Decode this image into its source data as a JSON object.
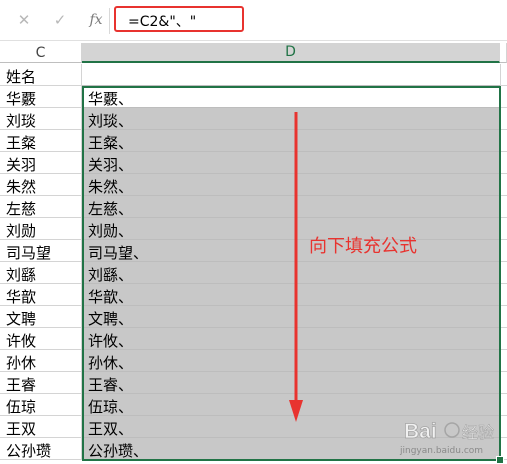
{
  "formula_bar": {
    "cancel_icon": "✕",
    "enter_icon": "✓",
    "fx_label": "fx",
    "formula": "=C2&\"、\""
  },
  "columns": {
    "c": "C",
    "d": "D"
  },
  "rows": [
    {
      "c": "姓名",
      "d": ""
    },
    {
      "c": "华覈",
      "d": "华覈、"
    },
    {
      "c": "刘琰",
      "d": "刘琰、"
    },
    {
      "c": "王粲",
      "d": "王粲、"
    },
    {
      "c": "关羽",
      "d": "关羽、"
    },
    {
      "c": "朱然",
      "d": "朱然、"
    },
    {
      "c": "左慈",
      "d": "左慈、"
    },
    {
      "c": "刘勋",
      "d": "刘勋、"
    },
    {
      "c": "司马望",
      "d": "司马望、"
    },
    {
      "c": "刘繇",
      "d": "刘繇、"
    },
    {
      "c": "华歆",
      "d": "华歆、"
    },
    {
      "c": "文聘",
      "d": "文聘、"
    },
    {
      "c": "许攸",
      "d": "许攸、"
    },
    {
      "c": "孙休",
      "d": "孙休、"
    },
    {
      "c": "王睿",
      "d": "王睿、"
    },
    {
      "c": "伍琼",
      "d": "伍琼、"
    },
    {
      "c": "王双",
      "d": "王双、"
    },
    {
      "c": "公孙瓒",
      "d": "公孙瓒、"
    }
  ],
  "annotation": "向下填充公式",
  "watermark": {
    "text": "Bai 经验",
    "url": "jingyan.baidu.com"
  },
  "colors": {
    "accent": "#217346",
    "annotation": "#e8332f",
    "selection_fill": "#c8c8c8"
  }
}
